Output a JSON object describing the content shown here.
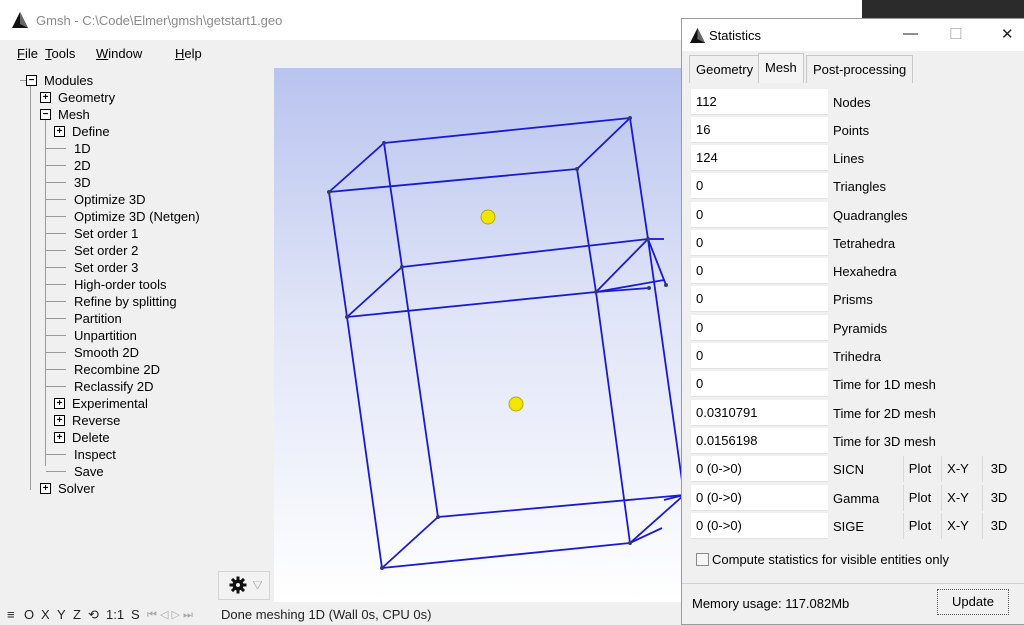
{
  "main_window": {
    "title": "Gmsh - C:\\Code\\Elmer\\gmsh\\getstart1.geo",
    "menu": [
      {
        "prefix": "",
        "underline": "F",
        "rest": "ile"
      },
      {
        "prefix": "",
        "underline": "T",
        "rest": "ools"
      },
      {
        "prefix": "",
        "underline": "W",
        "rest": "indow"
      },
      {
        "prefix": "",
        "underline": "H",
        "rest": "elp"
      }
    ],
    "tree": {
      "modules": "Modules",
      "geometry": "Geometry",
      "mesh": "Mesh",
      "define": "Define",
      "items": [
        "1D",
        "2D",
        "3D",
        "Optimize 3D",
        "Optimize 3D (Netgen)",
        "Set order 1",
        "Set order 2",
        "Set order 3",
        "High-order tools",
        "Refine by splitting",
        "Partition",
        "Unpartition",
        "Smooth 2D",
        "Recombine 2D",
        "Reclassify 2D"
      ],
      "experimental": "Experimental",
      "reverse": "Reverse",
      "delete": "Delete",
      "inspect": "Inspect",
      "save": "Save",
      "solver": "Solver",
      "expand_symbol": "+",
      "collapse_symbol": "−"
    },
    "status": {
      "menu_glyph": "≡",
      "o": "O",
      "x": "X",
      "y": "Y",
      "z": "Z",
      "rotate_glyph": "⟲",
      "scale": "1:1",
      "s": "S",
      "nav_glyphs": "⏮ ◁ ▷ ⏭",
      "message": "Done meshing 1D (Wall 0s, CPU 0s)"
    }
  },
  "stats_window": {
    "title": "Statistics",
    "controls": {
      "minimize": "—",
      "maximize": "☐",
      "close": "✕"
    },
    "tabs": [
      "Geometry",
      "Mesh",
      "Post-processing"
    ],
    "active_tab": "Mesh",
    "rows": [
      {
        "value": "112",
        "label": "Nodes"
      },
      {
        "value": "16",
        "label": "Points"
      },
      {
        "value": "124",
        "label": "Lines"
      },
      {
        "value": "0",
        "label": "Triangles"
      },
      {
        "value": "0",
        "label": "Quadrangles"
      },
      {
        "value": "0",
        "label": "Tetrahedra"
      },
      {
        "value": "0",
        "label": "Hexahedra"
      },
      {
        "value": "0",
        "label": "Prisms"
      },
      {
        "value": "0",
        "label": "Pyramids"
      },
      {
        "value": "0",
        "label": "Trihedra"
      },
      {
        "value": "0",
        "label": "Time for 1D mesh"
      },
      {
        "value": "0.0310791",
        "label": "Time for 2D mesh"
      },
      {
        "value": "0.0156198",
        "label": "Time for 3D mesh"
      }
    ],
    "quality_rows": [
      {
        "value": "0 (0->0)",
        "label": "SICN"
      },
      {
        "value": "0 (0->0)",
        "label": "Gamma"
      },
      {
        "value": "0 (0->0)",
        "label": "SIGE"
      }
    ],
    "quality_buttons": {
      "plot": "Plot",
      "xy": "X-Y",
      "d3": "3D"
    },
    "visible_only_label": "Compute statistics for visible entities only",
    "memory": "Memory usage: 117.082Mb",
    "update_label": "Update"
  },
  "colors": {
    "mesh_lines": "#1a1ad0",
    "points": "#f2e600",
    "viewport_top": "#b9c4ef",
    "viewport_bottom": "#ffffff"
  }
}
